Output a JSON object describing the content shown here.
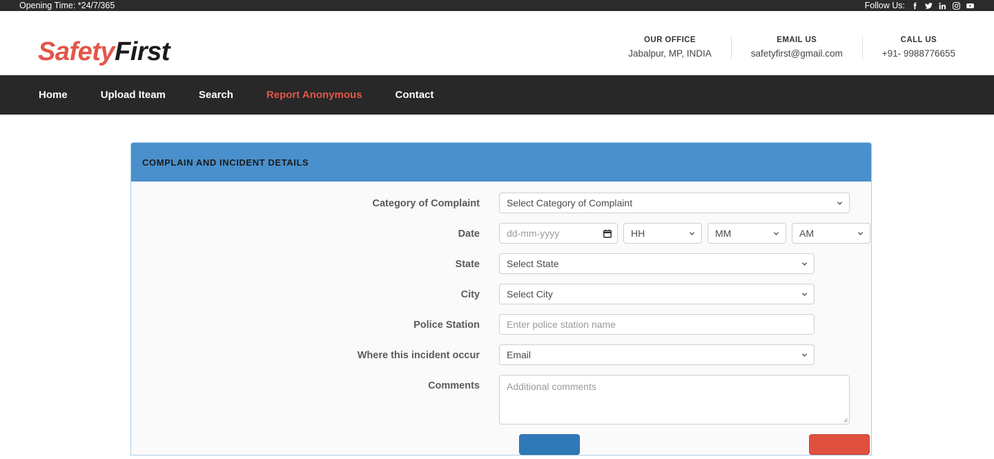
{
  "topbar": {
    "opening_time": "Opening Time: *24/7/365",
    "follow_label": "Follow Us:",
    "social": [
      {
        "name": "facebook-icon",
        "label": "Facebook"
      },
      {
        "name": "twitter-icon",
        "label": "Twitter"
      },
      {
        "name": "linkedin-icon",
        "label": "LinkedIn"
      },
      {
        "name": "instagram-icon",
        "label": "Instagram"
      },
      {
        "name": "youtube-icon",
        "label": "YouTube"
      }
    ]
  },
  "header": {
    "logo_part1": "Safety",
    "logo_part2": "First",
    "logo_color_1": "#e2564a",
    "logo_color_2": "#1c1c1c",
    "info": [
      {
        "title": "OUR OFFICE",
        "value": "Jabalpur, MP, INDIA"
      },
      {
        "title": "EMAIL US",
        "value": "safetyfirst@gmail.com"
      },
      {
        "title": "CALL US",
        "value": "+91- 9988776655"
      }
    ]
  },
  "nav": {
    "items": [
      {
        "label": "Home",
        "active": false
      },
      {
        "label": "Upload Iteam",
        "active": false
      },
      {
        "label": "Search",
        "active": false
      },
      {
        "label": "Report Anonymous",
        "active": true
      },
      {
        "label": "Contact",
        "active": false
      }
    ],
    "active_color": "#e2564a",
    "background": "#282828"
  },
  "panel": {
    "title": "COMPLAIN AND INCIDENT DETAILS",
    "header_color": "#4a90cc",
    "border_color": "#a9cde8"
  },
  "form": {
    "category": {
      "label": "Category of Complaint",
      "selected": "Select Category of Complaint"
    },
    "date": {
      "label": "Date",
      "date_placeholder": "dd-mm-yyyy",
      "hour_selected": "HH",
      "minute_selected": "MM",
      "meridiem_selected": "AM"
    },
    "state": {
      "label": "State",
      "selected": "Select State"
    },
    "city": {
      "label": "City",
      "selected": "Select City"
    },
    "police_station": {
      "label": "Police Station",
      "placeholder": "Enter police station name",
      "value": ""
    },
    "where": {
      "label": "Where this incident occur",
      "selected": "Email"
    },
    "comments": {
      "label": "Comments",
      "placeholder": "Additional comments",
      "value": ""
    },
    "buttons": {
      "submit_label": "",
      "reset_label": "",
      "submit_color": "#3079b8",
      "reset_color": "#e0503f"
    }
  }
}
